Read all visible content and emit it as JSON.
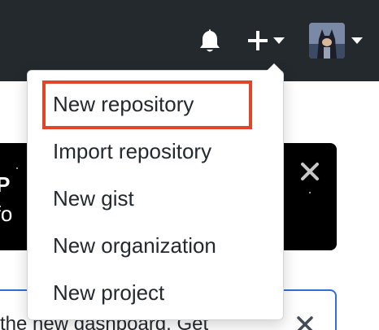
{
  "header": {
    "bell_icon": "bell-icon",
    "plus_icon": "plus-icon",
    "avatar_icon": "user-avatar",
    "colors": {
      "bar": "#24292e",
      "icon": "#ffffff"
    }
  },
  "dropdown": {
    "items": [
      {
        "label": "New repository"
      },
      {
        "label": "Import repository"
      },
      {
        "label": "New gist"
      },
      {
        "label": "New organization"
      },
      {
        "label": "New project"
      }
    ],
    "highlight_color": "#e0452b"
  },
  "background": {
    "promo_line1": "b P",
    "promo_line2": "o fo",
    "notice_text": "the new dashboard. Get"
  }
}
